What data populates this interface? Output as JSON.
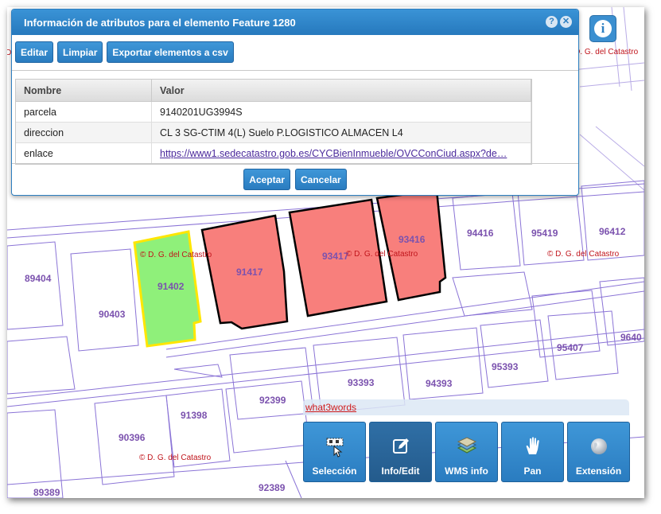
{
  "dialog": {
    "title": "Información de atributos para el elemento Feature 1280",
    "help_icon": "help-icon",
    "close_icon": "close-icon",
    "toolbar": {
      "edit": "Editar",
      "clear": "Limpiar",
      "export": "Exportar elementos a csv"
    },
    "columns": [
      "Nombre",
      "Valor"
    ],
    "rows": [
      {
        "name": "parcela",
        "value": "9140201UG3994S"
      },
      {
        "name": "direccion",
        "value": "CL 3 SG-CTIM 4(L) Suelo P.LOGISTICO ALMACEN L4"
      },
      {
        "name": "enlace",
        "value": "https://www1.sedecatastro.gob.es/CYCBienInmueble/OVCConCiud.aspx?de…"
      }
    ],
    "accept": "Aceptar",
    "cancel": "Cancelar"
  },
  "map": {
    "parcels": {
      "p89404": "89404",
      "p90403": "90403",
      "p91402": "91402",
      "p91417": "91417",
      "p93417": "93417",
      "p93416": "93416",
      "p94416": "94416",
      "p95419": "95419",
      "p96412": "96412",
      "p95407": "95407",
      "p9640": "9640",
      "p93393": "93393",
      "p94393": "94393",
      "p95393": "95393",
      "p92399": "92399",
      "p91398": "91398",
      "p90396": "90396",
      "p92389": "92389",
      "p89389": "89389"
    },
    "attribution": "© D. G. del Catastro",
    "colors": {
      "selected": "#f87f7c",
      "highlight": "#8ff07a",
      "parcel_line": "#8a73d6"
    }
  },
  "info_button_icon": "info-icon",
  "w3w_link": "what3words",
  "tools": [
    {
      "label": "Selección",
      "icon": "selection-icon"
    },
    {
      "label": "Info/Edit",
      "icon": "edit-icon"
    },
    {
      "label": "WMS info",
      "icon": "layers-icon"
    },
    {
      "label": "Pan",
      "icon": "hand-icon"
    },
    {
      "label": "Extensión",
      "icon": "globe-icon"
    }
  ]
}
